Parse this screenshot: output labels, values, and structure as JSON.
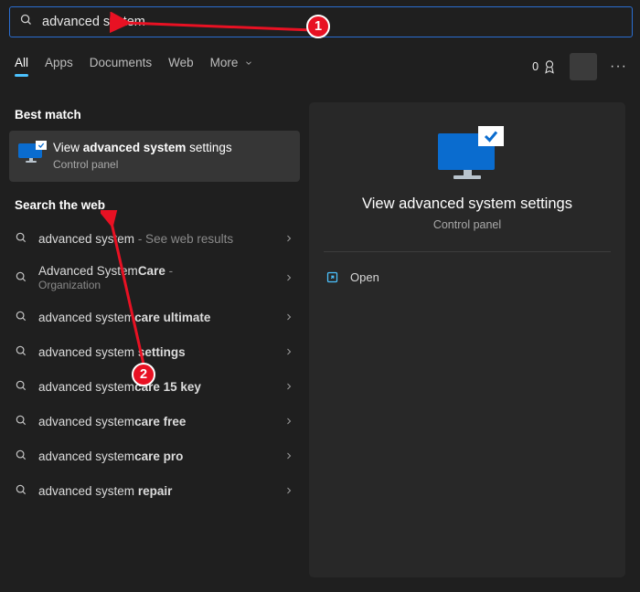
{
  "search": {
    "value": "advanced system"
  },
  "tabs": {
    "all": "All",
    "apps": "Apps",
    "documents": "Documents",
    "web": "Web",
    "more": "More"
  },
  "rewards": {
    "count": "0"
  },
  "sections": {
    "best": "Best match",
    "web": "Search the web"
  },
  "best": {
    "prefix": "View ",
    "bold": "advanced system",
    "suffix": " settings",
    "sub": "Control panel"
  },
  "suggestions": [
    {
      "prefix": "advanced system",
      "bold": "",
      "hint": " - See web results",
      "sub": ""
    },
    {
      "prefix": "Advanced System",
      "bold": "Care",
      "hint": " -",
      "sub": "Organization"
    },
    {
      "prefix": "advanced system",
      "bold": "care ultimate",
      "hint": "",
      "sub": ""
    },
    {
      "prefix": "advanced system ",
      "bold": "settings",
      "hint": "",
      "sub": ""
    },
    {
      "prefix": "advanced system",
      "bold": "care 15 key",
      "hint": "",
      "sub": ""
    },
    {
      "prefix": "advanced system",
      "bold": "care free",
      "hint": "",
      "sub": ""
    },
    {
      "prefix": "advanced system",
      "bold": "care pro",
      "hint": "",
      "sub": ""
    },
    {
      "prefix": "advanced system ",
      "bold": "repair",
      "hint": "",
      "sub": ""
    }
  ],
  "preview": {
    "title": "View advanced system settings",
    "sub": "Control panel",
    "open": "Open"
  },
  "annotations": {
    "c1": "1",
    "c2": "2"
  }
}
